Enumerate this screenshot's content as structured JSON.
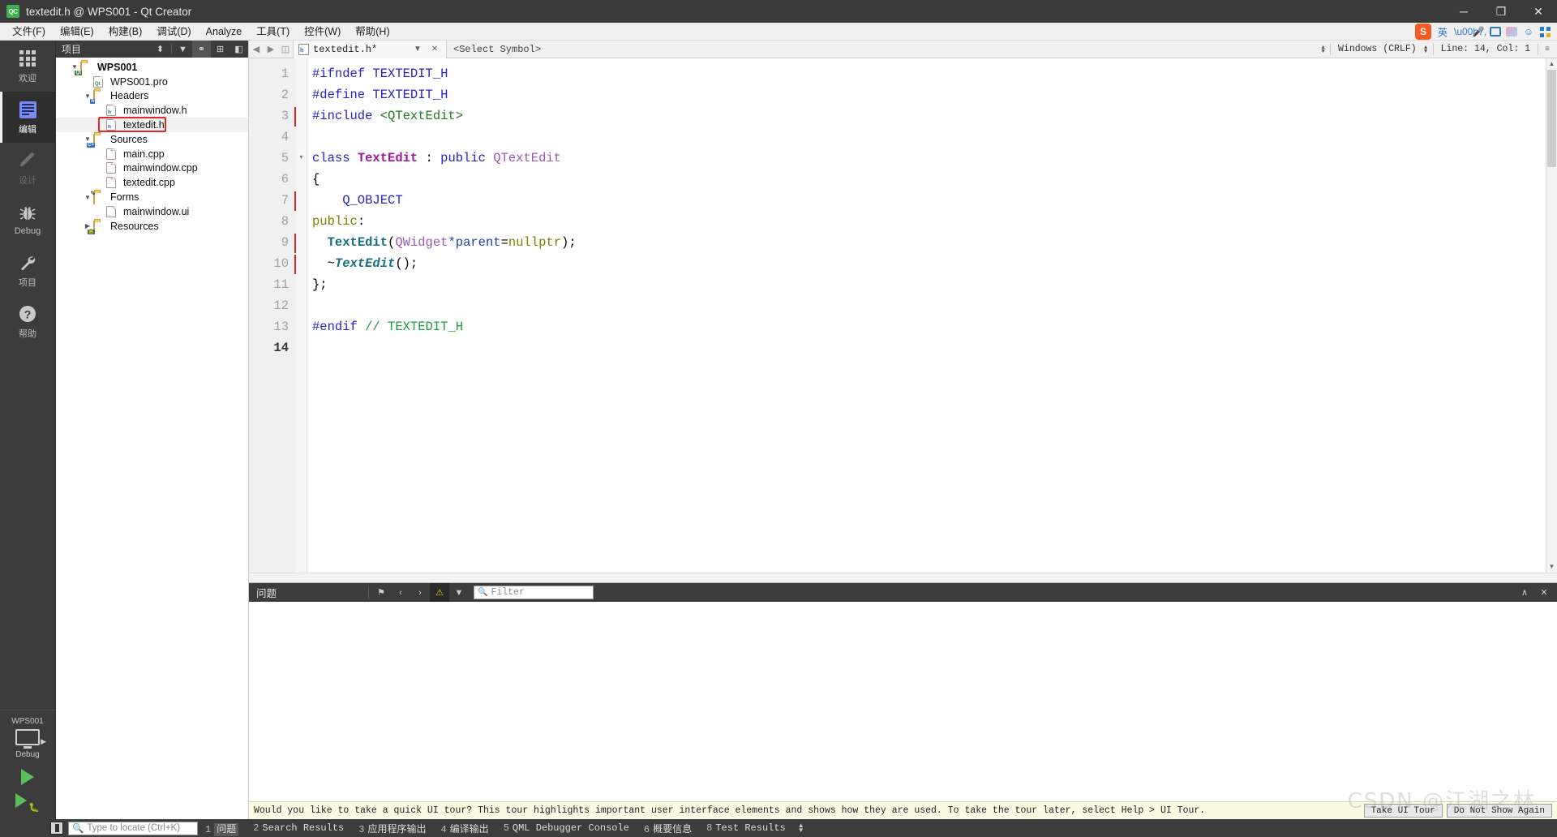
{
  "window": {
    "title": "textedit.h @ WPS001 - Qt Creator",
    "app_icon": "qt-creator-icon",
    "minimize": "─",
    "maximize": "❐",
    "close": "✕"
  },
  "menubar": {
    "items": [
      {
        "label": "文件(F)",
        "name": "menu-file"
      },
      {
        "label": "编辑(E)",
        "name": "menu-edit"
      },
      {
        "label": "构建(B)",
        "name": "menu-build"
      },
      {
        "label": "调试(D)",
        "name": "menu-debug"
      },
      {
        "label": "Analyze",
        "name": "menu-analyze"
      },
      {
        "label": "工具(T)",
        "name": "menu-tools"
      },
      {
        "label": "控件(W)",
        "name": "menu-window"
      },
      {
        "label": "帮助(H)",
        "name": "menu-help"
      }
    ]
  },
  "tray": {
    "logo": "S",
    "lang": "英"
  },
  "moderail": {
    "items": [
      {
        "label": "欢迎",
        "icon": "grid-icon",
        "active": false,
        "disabled": false
      },
      {
        "label": "编辑",
        "icon": "edit-icon",
        "active": true,
        "disabled": false
      },
      {
        "label": "设计",
        "icon": "pencil-icon",
        "active": false,
        "disabled": true
      },
      {
        "label": "Debug",
        "icon": "bug-icon",
        "active": false,
        "disabled": false
      },
      {
        "label": "项目",
        "icon": "wrench-icon",
        "active": false,
        "disabled": false
      },
      {
        "label": "帮助",
        "icon": "question-icon",
        "active": false,
        "disabled": false
      }
    ],
    "kit_name": "WPS001",
    "kit_config": "Debug"
  },
  "sidebar": {
    "header_title": "项目",
    "header_buttons": [
      {
        "name": "sidebar-sort-button",
        "glyph": "⬍"
      },
      {
        "name": "sidebar-filter-button",
        "glyph": "▼"
      },
      {
        "name": "sidebar-sync-button",
        "glyph": "⚭"
      },
      {
        "name": "sidebar-split-button",
        "glyph": "⊞"
      },
      {
        "name": "sidebar-close-button",
        "glyph": "◧"
      }
    ],
    "tree": [
      {
        "label": "WPS001",
        "depth": 0,
        "twisty": "down",
        "icon": "qt-project-folder",
        "bold": true,
        "selected": false,
        "highlight": false
      },
      {
        "label": "WPS001.pro",
        "depth": 1,
        "twisty": "none",
        "icon": "qt-pro-file",
        "bold": false,
        "selected": false,
        "highlight": false
      },
      {
        "label": "Headers",
        "depth": 1,
        "twisty": "down",
        "icon": "folder-h",
        "bold": false,
        "selected": false,
        "highlight": false
      },
      {
        "label": "mainwindow.h",
        "depth": 2,
        "twisty": "none",
        "icon": "header-file",
        "bold": false,
        "selected": false,
        "highlight": false
      },
      {
        "label": "textedit.h",
        "depth": 2,
        "twisty": "none",
        "icon": "header-file",
        "bold": false,
        "selected": true,
        "highlight": true
      },
      {
        "label": "Sources",
        "depth": 1,
        "twisty": "down",
        "icon": "folder-cpp",
        "bold": false,
        "selected": false,
        "highlight": false
      },
      {
        "label": "main.cpp",
        "depth": 2,
        "twisty": "none",
        "icon": "cpp-file",
        "bold": false,
        "selected": false,
        "highlight": false
      },
      {
        "label": "mainwindow.cpp",
        "depth": 2,
        "twisty": "none",
        "icon": "cpp-file",
        "bold": false,
        "selected": false,
        "highlight": false
      },
      {
        "label": "textedit.cpp",
        "depth": 2,
        "twisty": "none",
        "icon": "cpp-file",
        "bold": false,
        "selected": false,
        "highlight": false
      },
      {
        "label": "Forms",
        "depth": 1,
        "twisty": "down",
        "icon": "folder-forms",
        "bold": false,
        "selected": false,
        "highlight": false
      },
      {
        "label": "mainwindow.ui",
        "depth": 2,
        "twisty": "none",
        "icon": "ui-file",
        "bold": false,
        "selected": false,
        "highlight": false
      },
      {
        "label": "Resources",
        "depth": 1,
        "twisty": "right",
        "icon": "folder-res",
        "bold": false,
        "selected": false,
        "highlight": false
      }
    ]
  },
  "editor": {
    "tab_name": "textedit.h*",
    "tab_icon": "header-file-icon",
    "symbol_selector": "<Select Symbol>",
    "line_ending": "Windows (CRLF)",
    "cursor_position": "Line: 14, Col: 1",
    "lines": [
      {
        "n": "1",
        "mark": false,
        "fold": "",
        "tokens": [
          {
            "t": "#ifndef ",
            "c": "k-pre"
          },
          {
            "t": "TEXTEDIT_H",
            "c": "k-pre"
          }
        ]
      },
      {
        "n": "2",
        "mark": false,
        "fold": "",
        "tokens": [
          {
            "t": "#define ",
            "c": "k-pre"
          },
          {
            "t": "TEXTEDIT_H",
            "c": "k-pre"
          }
        ]
      },
      {
        "n": "3",
        "mark": true,
        "fold": "",
        "tokens": [
          {
            "t": "#include ",
            "c": "k-pre"
          },
          {
            "t": "<QTextEdit>",
            "c": "k-str"
          }
        ]
      },
      {
        "n": "4",
        "mark": false,
        "fold": "",
        "tokens": [
          {
            "t": "",
            "c": "k-op"
          }
        ]
      },
      {
        "n": "5",
        "mark": false,
        "fold": "▾",
        "tokens": [
          {
            "t": "class ",
            "c": "k-kw2"
          },
          {
            "t": "TextEdit",
            "c": "k-type"
          },
          {
            "t": " : ",
            "c": "k-op"
          },
          {
            "t": "public ",
            "c": "k-kw2"
          },
          {
            "t": "QTextEdit",
            "c": "k-type2"
          }
        ]
      },
      {
        "n": "6",
        "mark": false,
        "fold": "",
        "tokens": [
          {
            "t": "{",
            "c": "k-op"
          }
        ]
      },
      {
        "n": "7",
        "mark": true,
        "fold": "",
        "tokens": [
          {
            "t": "    Q_OBJECT",
            "c": "k-mac"
          }
        ]
      },
      {
        "n": "8",
        "mark": false,
        "fold": "",
        "tokens": [
          {
            "t": "public",
            "c": "k-kw"
          },
          {
            "t": ":",
            "c": "k-op"
          }
        ]
      },
      {
        "n": "9",
        "mark": true,
        "fold": "",
        "tokens": [
          {
            "t": "  ",
            "c": "k-op"
          },
          {
            "t": "TextEdit",
            "c": "k-fn"
          },
          {
            "t": "(",
            "c": "k-op"
          },
          {
            "t": "QWidget",
            "c": "k-type2"
          },
          {
            "t": "*parent",
            "c": "k-var"
          },
          {
            "t": "=",
            "c": "k-op"
          },
          {
            "t": "nullptr",
            "c": "k-kw"
          },
          {
            "t": ");",
            "c": "k-op"
          }
        ]
      },
      {
        "n": "10",
        "mark": true,
        "fold": "",
        "tokens": [
          {
            "t": "  ~",
            "c": "k-op"
          },
          {
            "t": "TextEdit",
            "c": "k-fn-it"
          },
          {
            "t": "();",
            "c": "k-op"
          }
        ]
      },
      {
        "n": "11",
        "mark": false,
        "fold": "",
        "tokens": [
          {
            "t": "};",
            "c": "k-op"
          }
        ]
      },
      {
        "n": "12",
        "mark": false,
        "fold": "",
        "tokens": [
          {
            "t": "",
            "c": "k-op"
          }
        ]
      },
      {
        "n": "13",
        "mark": false,
        "fold": "",
        "tokens": [
          {
            "t": "#endif ",
            "c": "k-pre"
          },
          {
            "t": "// TEXTEDIT_H",
            "c": "k-cmt"
          }
        ]
      },
      {
        "n": "14",
        "mark": false,
        "fold": "",
        "tokens": [
          {
            "t": "",
            "c": "k-op"
          }
        ],
        "current": true
      }
    ]
  },
  "issues_pane": {
    "title": "问题",
    "filter_placeholder": "Filter",
    "buttons": [
      {
        "name": "clear-button",
        "glyph": "⚑"
      },
      {
        "name": "prev-issue-button",
        "glyph": "‹"
      },
      {
        "name": "next-issue-button",
        "glyph": "›"
      },
      {
        "name": "warnings-filter-button",
        "glyph": "⚠"
      },
      {
        "name": "filter-dropdown-button",
        "glyph": "▼"
      }
    ],
    "right_buttons": [
      {
        "name": "maximize-pane-button",
        "glyph": "∧"
      },
      {
        "name": "close-pane-button",
        "glyph": "✕"
      }
    ]
  },
  "tour_banner": {
    "message": "Would you like to take a quick UI tour? This tour highlights important user interface elements and shows how they are used. To take the tour later, select Help > UI Tour.",
    "primary_button": "Take UI Tour",
    "secondary_button": "Do Not Show Again"
  },
  "statusbar": {
    "locator_placeholder": "Type to locate (Ctrl+K)",
    "items": [
      {
        "num": "1",
        "label": "问题",
        "active": true
      },
      {
        "num": "2",
        "label": "Search Results",
        "active": false
      },
      {
        "num": "3",
        "label": "应用程序输出",
        "active": false
      },
      {
        "num": "4",
        "label": "编译输出",
        "active": false
      },
      {
        "num": "5",
        "label": "QML Debugger Console",
        "active": false
      },
      {
        "num": "6",
        "label": "概要信息",
        "active": false
      },
      {
        "num": "8",
        "label": "Test Results",
        "active": false
      }
    ]
  },
  "watermark": "CSDN @江湖之林",
  "colors": {
    "titlebar_bg": "#3a3a3a",
    "rail_bg": "#3c3c3c",
    "accent_red": "#e8252a",
    "warning_yellow": "#f5c518",
    "tour_bg": "#fbfbe4"
  }
}
